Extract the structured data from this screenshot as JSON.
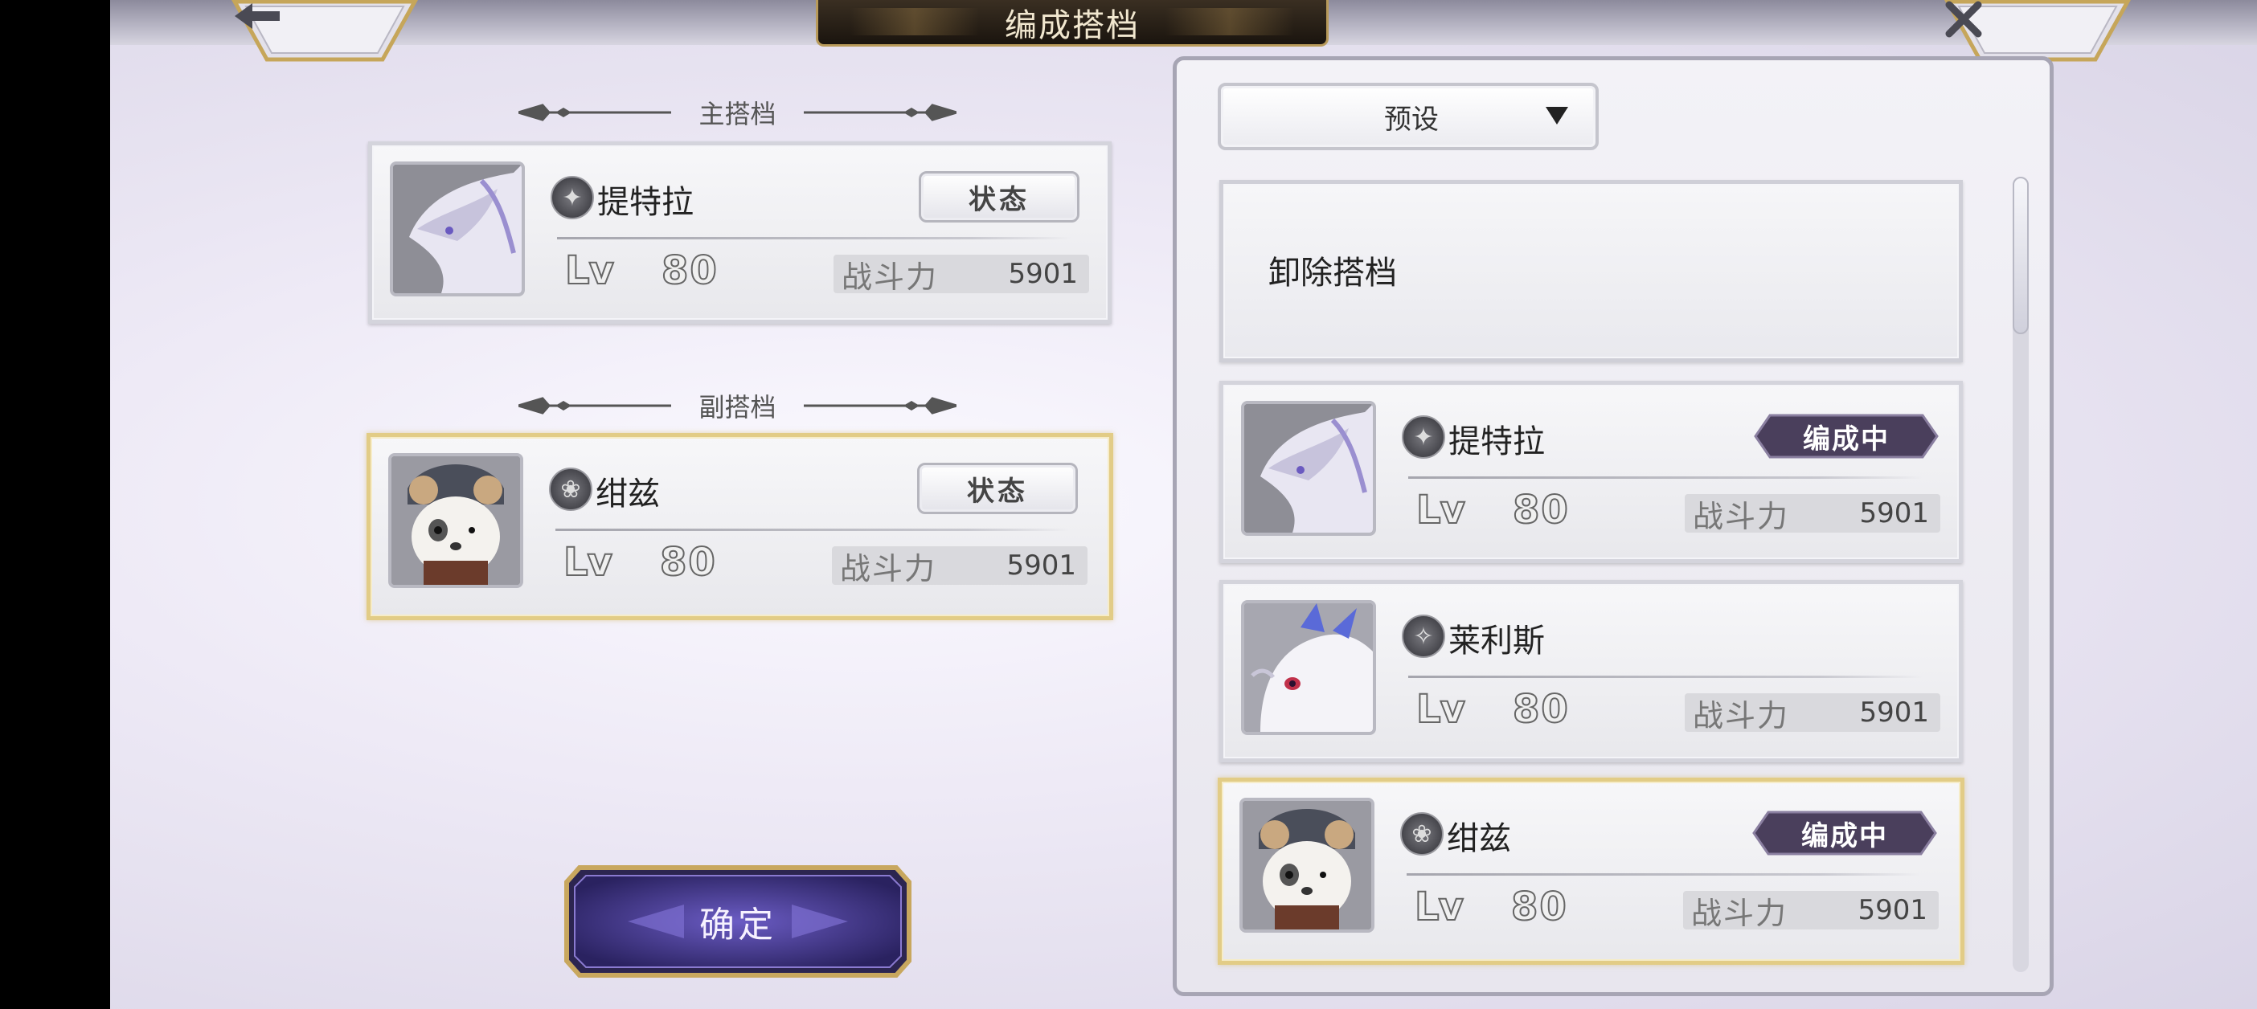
{
  "header": {
    "title": "编成搭档",
    "back_icon": "back-arrow-icon",
    "close_icon": "close-x-icon"
  },
  "main_partner": {
    "section_label": "主搭档",
    "name": "提特拉",
    "element_icon": "dark-element-icon",
    "status_label": "状态",
    "lv_label": "Lv",
    "level": "80",
    "power_label": "战斗力",
    "power": "5901"
  },
  "sub_partner": {
    "section_label": "副搭档",
    "name": "绀兹",
    "element_icon": "wind-element-icon",
    "status_label": "状态",
    "lv_label": "Lv",
    "level": "80",
    "power_label": "战斗力",
    "power": "5901"
  },
  "confirm_label": "确定",
  "preset": {
    "label": "预设"
  },
  "unequip_label": "卸除搭档",
  "list": [
    {
      "name": "提特拉",
      "badge": "编成中",
      "lv_label": "Lv",
      "level": "80",
      "power_label": "战斗力",
      "power": "5901"
    },
    {
      "name": "莱利斯",
      "lv_label": "Lv",
      "level": "80",
      "power_label": "战斗力",
      "power": "5901"
    },
    {
      "name": "绀兹",
      "badge": "编成中",
      "lv_label": "Lv",
      "level": "80",
      "power_label": "战斗力",
      "power": "5901"
    }
  ],
  "colors": {
    "gold_border": "#e2cc86",
    "badge": "#4a3f5c",
    "confirm": "#3b2f7a"
  }
}
